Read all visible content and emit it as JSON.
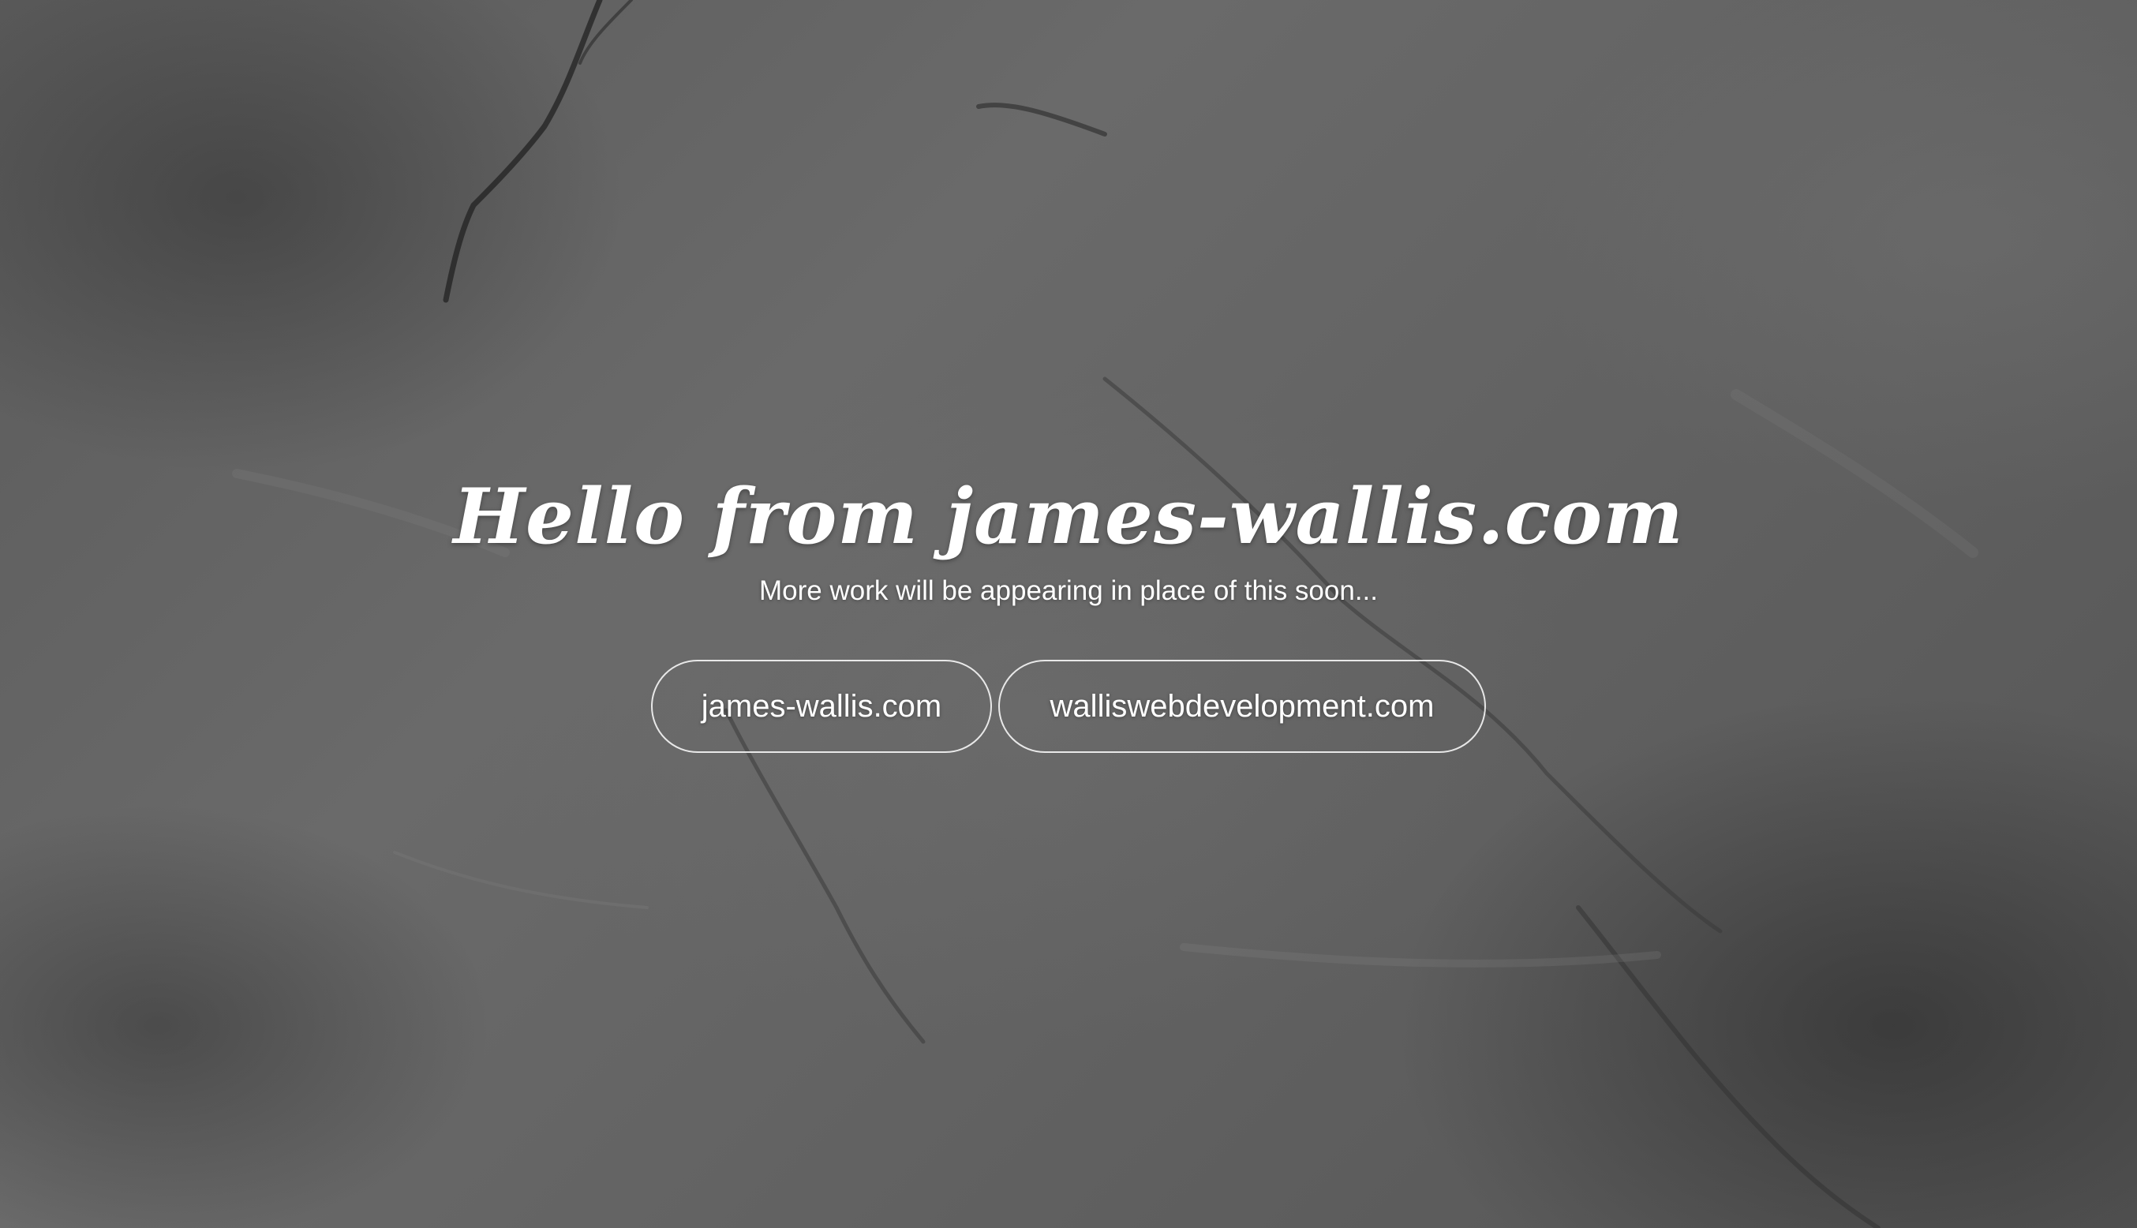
{
  "hero": {
    "title": "Hello from james-wallis.com",
    "subtitle": "More work will be appearing in place of this soon..."
  },
  "links": [
    {
      "label": "james-wallis.com"
    },
    {
      "label": "walliswebdevelopment.com"
    }
  ],
  "colors": {
    "text": "#ffffff",
    "background": "#5f5f5f"
  }
}
